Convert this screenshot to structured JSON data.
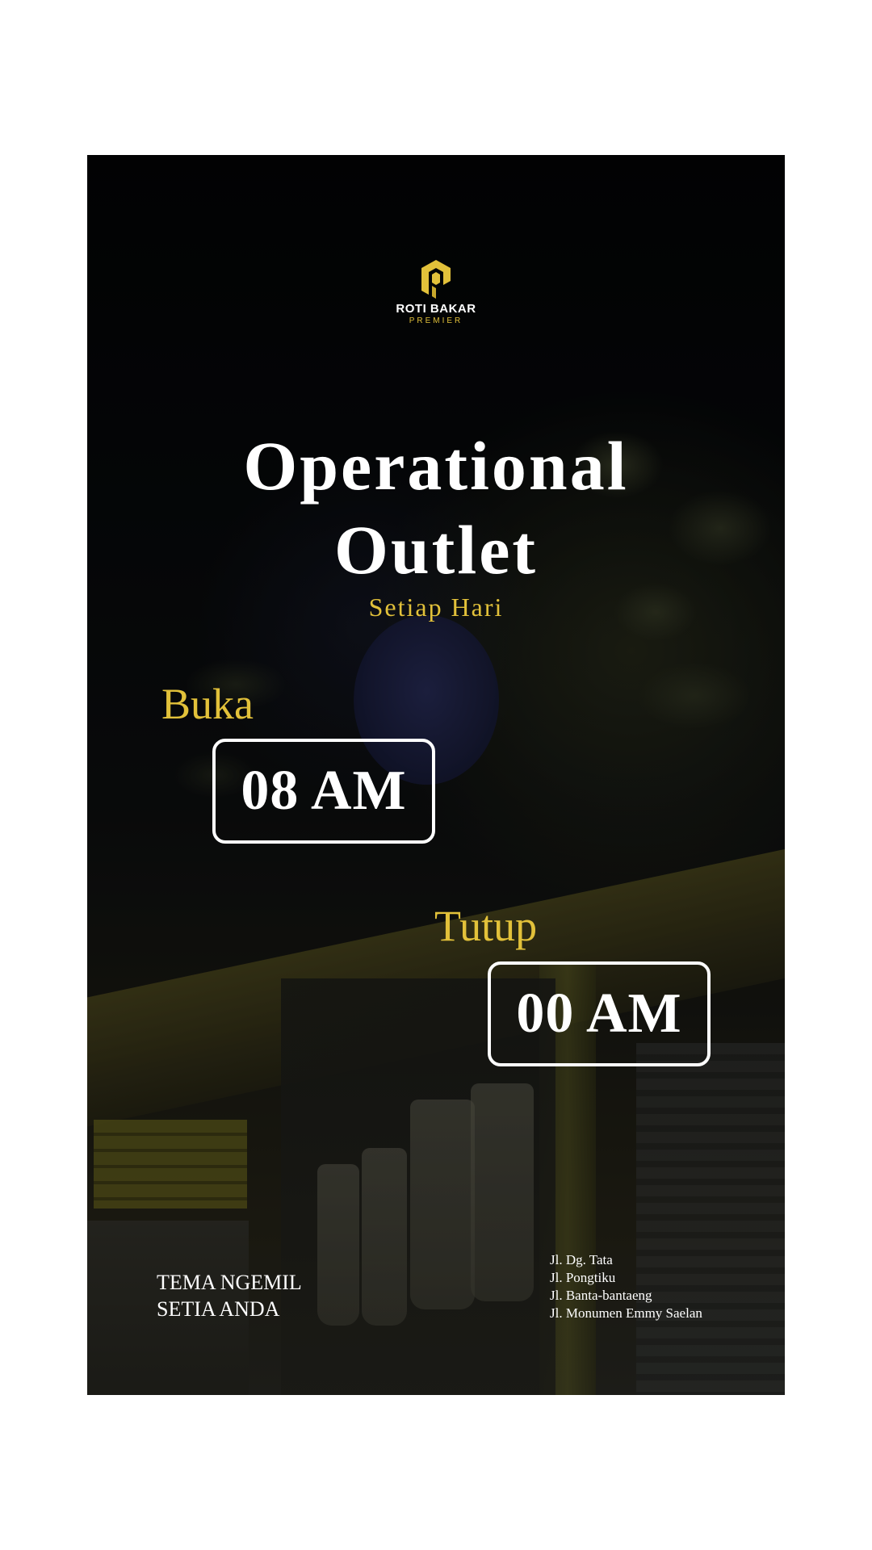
{
  "brand": {
    "name": "ROTI BAKAR",
    "sub": "PREMIER",
    "accent_color": "#e2c13a",
    "logo_icon": "hexagon-p-logo-icon"
  },
  "title": {
    "line1": "Operational",
    "line2": "Outlet"
  },
  "subtitle": "Setiap Hari",
  "open": {
    "label": "Buka",
    "time": "08 AM"
  },
  "close": {
    "label": "Tutup",
    "time": "00 AM"
  },
  "tagline": {
    "line1": "TEMA NGEMIL",
    "line2": "SETIA ANDA"
  },
  "addresses": [
    "Jl. Dg. Tata",
    "Jl. Pongtiku",
    "Jl. Banta-bantaeng",
    "Jl. Monumen Emmy Saelan"
  ]
}
